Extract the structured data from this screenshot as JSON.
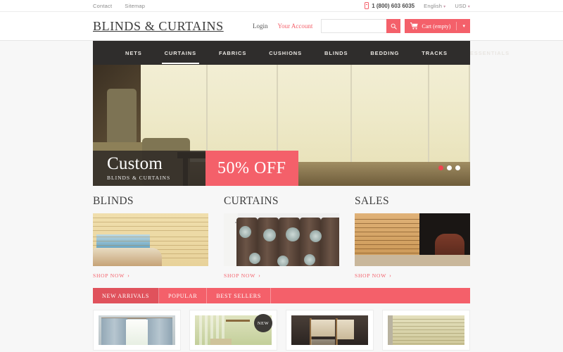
{
  "topbar": {
    "links": [
      {
        "label": "Contact"
      },
      {
        "label": "Sitemap"
      }
    ],
    "phone": "1 (800) 603 6035",
    "language": "English",
    "currency": "USD",
    "caret": "▾",
    "phone_icon": "phone-icon"
  },
  "header": {
    "logo": "BLINDS & CURTAINS",
    "login_label": "Login",
    "account_label": "Your Account",
    "search_placeholder": "",
    "search_value": "",
    "search_icon": "search-icon",
    "cart_icon": "cart-icon",
    "cart_label": "Cart (empty)",
    "cart_caret": "▾",
    "accent_color": "#f4606a"
  },
  "nav": {
    "items": [
      {
        "label": "NETS",
        "active": false
      },
      {
        "label": "CURTAINS",
        "active": true
      },
      {
        "label": "FABRICS",
        "active": false
      },
      {
        "label": "CUSHIONS",
        "active": false
      },
      {
        "label": "BLINDS",
        "active": false
      },
      {
        "label": "BEDDING",
        "active": false
      },
      {
        "label": "TRACKS",
        "active": false
      },
      {
        "label": "ESSENTIALS",
        "active": false
      }
    ],
    "bg_color": "#2f2d2c"
  },
  "hero": {
    "caption_title": "Custom",
    "caption_sub": "BLINDS & CURTAINS",
    "offer": "50% OFF",
    "dots": [
      {
        "active": true
      },
      {
        "active": false
      },
      {
        "active": false
      }
    ]
  },
  "categories": [
    {
      "title": "BLINDS",
      "shop_label": "SHOP NOW",
      "chevron": "›"
    },
    {
      "title": "CURTAINS",
      "shop_label": "SHOP NOW",
      "chevron": "›"
    },
    {
      "title": "SALES",
      "shop_label": "SHOP NOW",
      "chevron": "›"
    }
  ],
  "tabs": [
    {
      "label": "NEW ARRIVALS",
      "active": true
    },
    {
      "label": "POPULAR",
      "active": false
    },
    {
      "label": "BEST SELLERS",
      "active": false
    }
  ],
  "products": [
    {
      "badge": ""
    },
    {
      "badge": "NEW"
    },
    {
      "badge": ""
    },
    {
      "badge": ""
    }
  ]
}
